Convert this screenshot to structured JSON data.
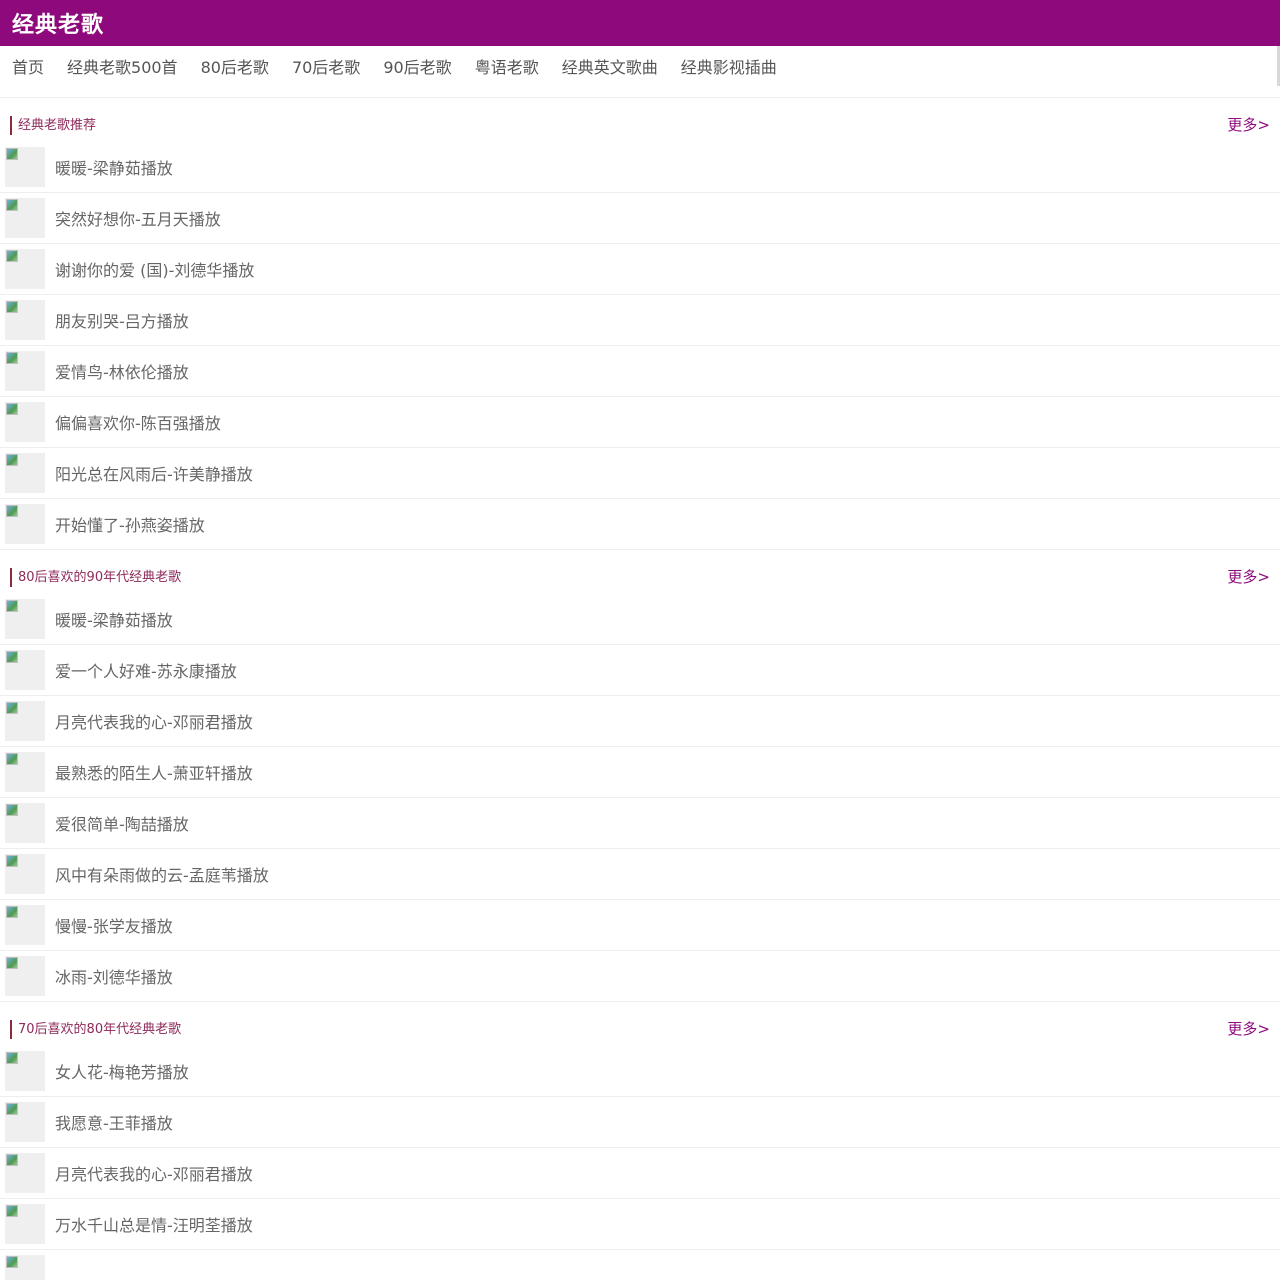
{
  "site": {
    "title": "经典老歌"
  },
  "nav": [
    {
      "label": "首页"
    },
    {
      "label": "经典老歌500首"
    },
    {
      "label": "80后老歌"
    },
    {
      "label": "70后老歌"
    },
    {
      "label": "90后老歌"
    },
    {
      "label": "粤语老歌"
    },
    {
      "label": "经典英文歌曲"
    },
    {
      "label": "经典影视插曲"
    }
  ],
  "sections": [
    {
      "title": "经典老歌推荐",
      "more": "更多>",
      "songs": [
        {
          "label": "暖暖-梁静茹播放"
        },
        {
          "label": "突然好想你-五月天播放"
        },
        {
          "label": "谢谢你的爱 (国)-刘德华播放"
        },
        {
          "label": "朋友别哭-吕方播放"
        },
        {
          "label": "爱情鸟-林依伦播放"
        },
        {
          "label": "偏偏喜欢你-陈百强播放"
        },
        {
          "label": "阳光总在风雨后-许美静播放"
        },
        {
          "label": "开始懂了-孙燕姿播放"
        }
      ]
    },
    {
      "title": "80后喜欢的90年代经典老歌",
      "more": "更多>",
      "songs": [
        {
          "label": "暖暖-梁静茹播放"
        },
        {
          "label": "爱一个人好难-苏永康播放"
        },
        {
          "label": "月亮代表我的心-邓丽君播放"
        },
        {
          "label": "最熟悉的陌生人-萧亚轩播放"
        },
        {
          "label": "爱很简单-陶喆播放"
        },
        {
          "label": "风中有朵雨做的云-孟庭苇播放"
        },
        {
          "label": "慢慢-张学友播放"
        },
        {
          "label": "冰雨-刘德华播放"
        }
      ]
    },
    {
      "title": "70后喜欢的80年代经典老歌",
      "more": "更多>",
      "songs": [
        {
          "label": "女人花-梅艳芳播放"
        },
        {
          "label": "我愿意-王菲播放"
        },
        {
          "label": "月亮代表我的心-邓丽君播放"
        },
        {
          "label": "万水千山总是情-汪明荃播放"
        },
        {
          "label": ""
        }
      ]
    }
  ]
}
